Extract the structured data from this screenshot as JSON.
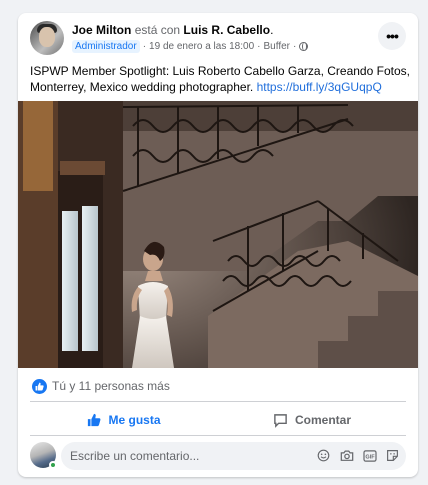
{
  "post": {
    "author": "Joe Milton",
    "connector": "está con",
    "tagged": "Luis R. Cabello",
    "period": ".",
    "role_badge": "Administrador",
    "date": "19 de enero a las 18:00",
    "source": "Buffer",
    "sep": "·",
    "privacy_icon": "globe-icon",
    "more_label": "•••",
    "text": "ISPWP Member Spotlight: Luis Roberto Cabello Garza, Creando Fotos, Monterrey, Mexico wedding photographer.",
    "link": "https://buff.ly/3qGUqpQ",
    "photo_alt": "Bride standing by a window beneath an ornate wrought-iron staircase"
  },
  "reactions": {
    "text": "Tú y 11 personas más",
    "icon": "like-icon"
  },
  "actions": {
    "like_label": "Me gusta",
    "comment_label": "Comentar"
  },
  "comment": {
    "placeholder": "Escribe un comentario...",
    "icons": [
      "emoji-icon",
      "camera-icon",
      "gif-icon",
      "sticker-icon"
    ]
  },
  "colors": {
    "accent": "#1877f2",
    "link": "#216fdb",
    "secondary_text": "#65676b",
    "background": "#f0f2f5",
    "online": "#31a24c"
  }
}
